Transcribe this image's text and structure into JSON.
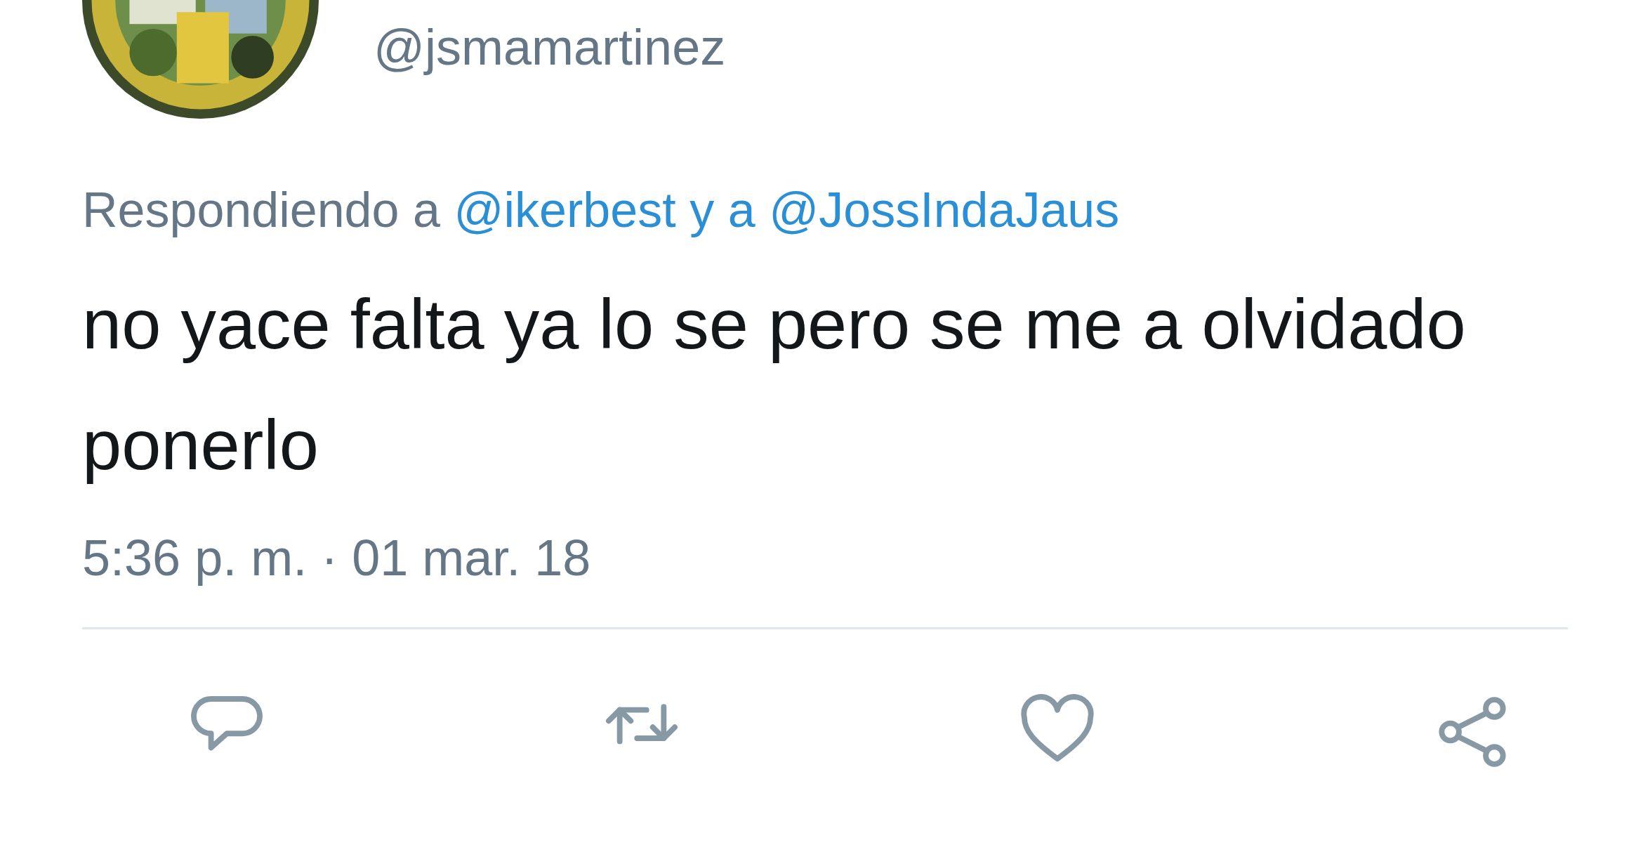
{
  "author": {
    "handle": "@jsmamartinez"
  },
  "reply_context": {
    "label": "Respondiendo a",
    "mentions": [
      "@ikerbest",
      "@JossIndaJaus"
    ],
    "connector": "y a"
  },
  "text": "no yace falta ya lo se pero se me a olvidado ponerlo",
  "timestamp": "5:36 p. m. · 01 mar. 18",
  "actions": [
    {
      "kind": "reply"
    },
    {
      "kind": "retweet"
    },
    {
      "kind": "like"
    },
    {
      "kind": "share"
    }
  ]
}
